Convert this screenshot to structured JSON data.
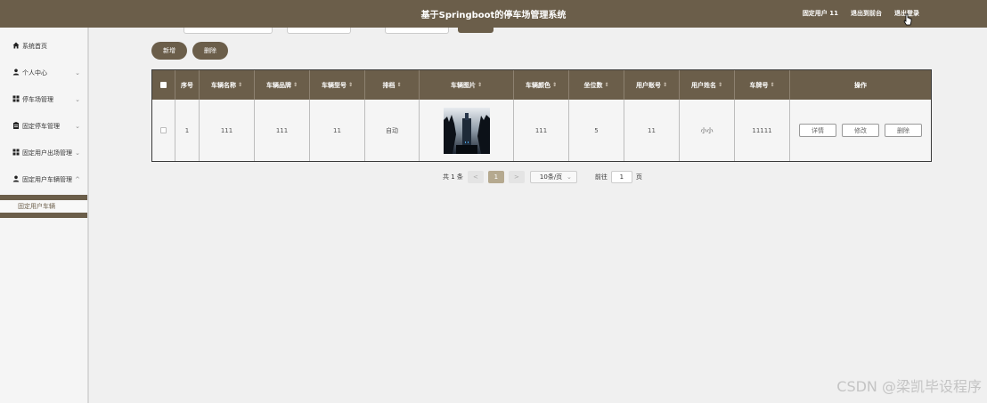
{
  "header": {
    "title": "基于Springboot的停车场管理系统",
    "user": "固定用户 11",
    "back_link": "退出到前台",
    "logout_link": "退出登录"
  },
  "sidebar": {
    "items": [
      {
        "label": "系统首页",
        "icon": "home-icon",
        "chevron": ""
      },
      {
        "label": "个人中心",
        "icon": "user-icon",
        "chevron": "⌄"
      },
      {
        "label": "停车场管理",
        "icon": "grid-icon",
        "chevron": "⌄"
      },
      {
        "label": "固定停车管理",
        "icon": "clipboard-icon",
        "chevron": "⌄"
      },
      {
        "label": "固定用户出场管理",
        "icon": "grid-icon",
        "chevron": "⌄"
      },
      {
        "label": "固定用户车辆管理",
        "icon": "user-icon",
        "chevron": "^"
      }
    ],
    "sub_item": "固定用户车辆"
  },
  "toolbar": {
    "add_label": "新增",
    "delete_label": "删除"
  },
  "table": {
    "headers": [
      "序号",
      "车辆名称",
      "车辆品牌",
      "车辆型号",
      "排档",
      "车辆图片",
      "车辆颜色",
      "坐位数",
      "用户账号",
      "用户姓名",
      "车牌号",
      "操作"
    ],
    "rows": [
      {
        "index": "1",
        "name": "111",
        "brand": "111",
        "model": "11",
        "gear": "自动",
        "color": "111",
        "seats": "5",
        "account": "11",
        "username": "小小",
        "plate": "11111"
      }
    ],
    "actions": {
      "detail": "详情",
      "edit": "修改",
      "delete": "删除"
    }
  },
  "pagination": {
    "total": "共 1 条",
    "prev": "<",
    "current": "1",
    "next": ">",
    "page_size": "10条/页",
    "goto_label": "前往",
    "goto_value": "1",
    "page_suffix": "页"
  },
  "watermark": "CSDN @梁凯毕设程序",
  "colors": {
    "brand": "#6b5e4a",
    "background": "#f0f0f0"
  }
}
